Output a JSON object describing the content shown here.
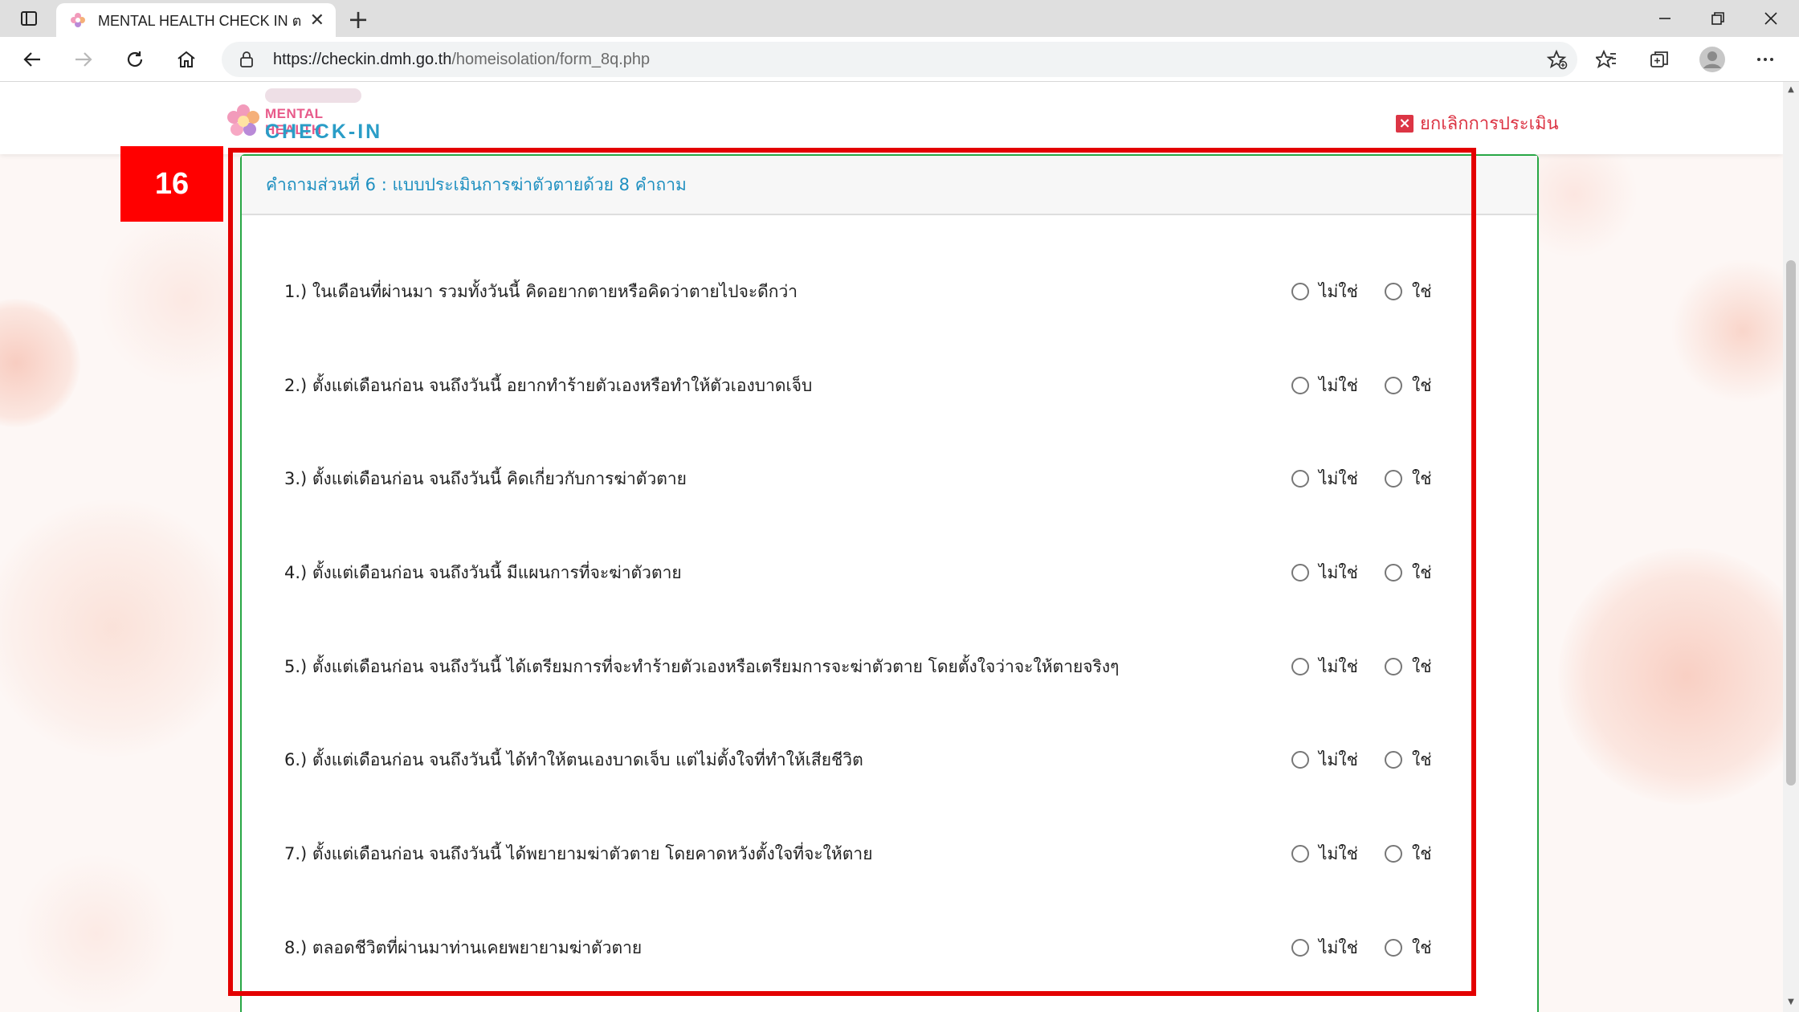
{
  "browser": {
    "tab_title": "MENTAL HEALTH CHECK IN ตรวจ",
    "url_host": "https://checkin.dmh.go.th",
    "url_path": "/homeisolation/form_8q.php"
  },
  "site": {
    "logo_tagline": "",
    "logo_line1": "MENTAL HEALTH",
    "logo_line2": "CHECK-IN",
    "cancel_label": "ยกเลิกการประเมิน"
  },
  "annotation": {
    "step_number": "16"
  },
  "form": {
    "section_title": "คำถามส่วนที่ 6 : แบบประเมินการฆ่าตัวตายด้วย 8 คำถาม",
    "option_no": "ไม่ใช่",
    "option_yes": "ใช่",
    "questions": [
      {
        "text": "1.) ในเดือนที่ผ่านมา รวมทั้งวันนี้ คิดอยากตายหรือคิดว่าตายไปจะดีกว่า",
        "selected": "none"
      },
      {
        "text": "2.) ตั้งแต่เดือนก่อน จนถึงวันนี้ อยากทำร้ายตัวเองหรือทำให้ตัวเองบาดเจ็บ",
        "selected": "none"
      },
      {
        "text": "3.) ตั้งแต่เดือนก่อน จนถึงวันนี้ คิดเกี่ยวกับการฆ่าตัวตาย",
        "selected": "none"
      },
      {
        "text": "4.) ตั้งแต่เดือนก่อน จนถึงวันนี้ มีแผนการที่จะฆ่าตัวตาย",
        "selected": "none"
      },
      {
        "text": "5.) ตั้งแต่เดือนก่อน จนถึงวันนี้ ได้เตรียมการที่จะทำร้ายตัวเองหรือเตรียมการจะฆ่าตัวตาย โดยตั้งใจว่าจะให้ตายจริงๆ",
        "selected": "none"
      },
      {
        "text": "6.) ตั้งแต่เดือนก่อน จนถึงวันนี้ ได้ทำให้ตนเองบาดเจ็บ แต่ไม่ตั้งใจที่ทำให้เสียชีวิต",
        "selected": "none"
      },
      {
        "text": "7.) ตั้งแต่เดือนก่อน จนถึงวันนี้ ได้พยายามฆ่าตัวตาย โดยคาดหวังตั้งใจที่จะให้ตาย",
        "selected": "none"
      },
      {
        "text": "8.) ตลอดชีวิตที่ผ่านมาท่านเคยพยายามฆ่าตัวตาย",
        "selected": "none"
      }
    ]
  },
  "colors": {
    "accent_green": "#28a745",
    "header_blue": "#1e8fc0",
    "cancel_red": "#dc3545",
    "annotation_red": "#e30000"
  }
}
